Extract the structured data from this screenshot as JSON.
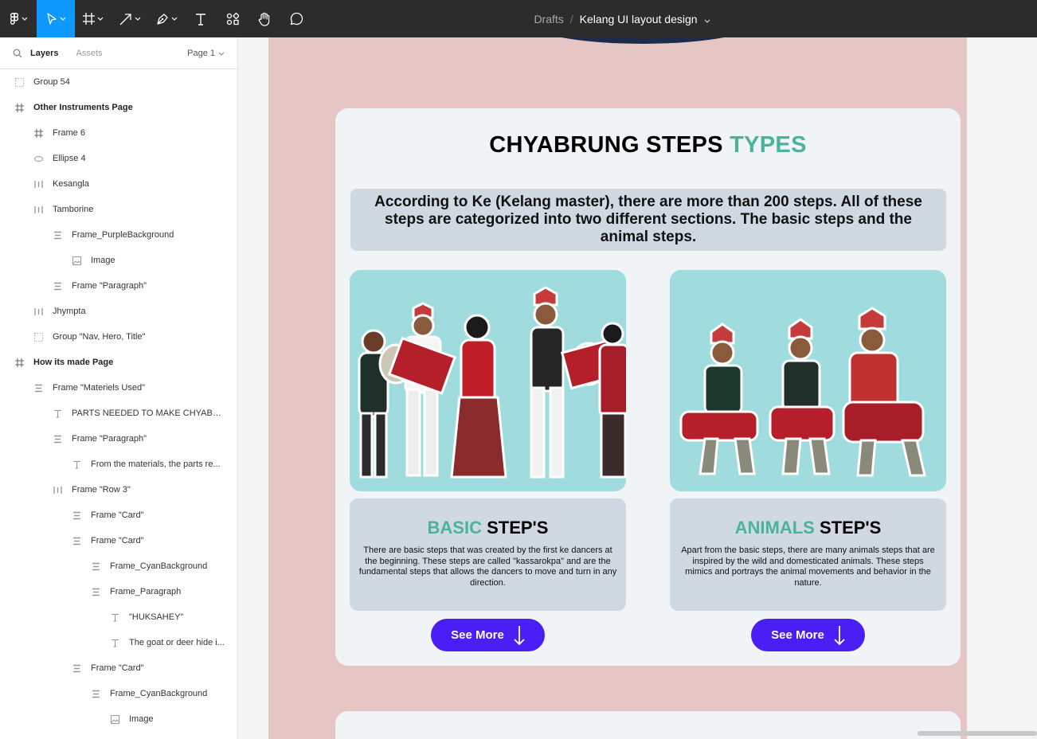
{
  "toolbar": {
    "breadcrumb_root": "Drafts",
    "breadcrumb_sep": "/",
    "file_name": "Kelang UI layout design",
    "accent_color": "#0d99ff"
  },
  "panel": {
    "tab_layers": "Layers",
    "tab_assets": "Assets",
    "page_selector": "Page 1",
    "layers": [
      {
        "label": "Group 54",
        "icon": "group-icon"
      },
      {
        "label": "Other Instruments Page",
        "icon": "frame-icon"
      },
      {
        "label": "Frame 6",
        "icon": "frame-icon"
      },
      {
        "label": "Ellipse 4",
        "icon": "ellipse-icon"
      },
      {
        "label": "Kesangla",
        "icon": "autolayout-horizontal-icon"
      },
      {
        "label": "Tamborine",
        "icon": "autolayout-horizontal-icon"
      },
      {
        "label": "Frame_PurpleBackground",
        "icon": "autolayout-vertical-icon"
      },
      {
        "label": "Image",
        "icon": "image-icon"
      },
      {
        "label": "Frame \"Paragraph\"",
        "icon": "autolayout-vertical-icon"
      },
      {
        "label": "Jhympta",
        "icon": "autolayout-horizontal-icon"
      },
      {
        "label": "Group \"Nav, Hero, Title\"",
        "icon": "group-icon"
      },
      {
        "label": "How its made Page",
        "icon": "frame-icon"
      },
      {
        "label": "Frame \"Materiels Used\"",
        "icon": "autolayout-vertical-icon"
      },
      {
        "label": "PARTS NEEDED TO MAKE CHYABRU...",
        "icon": "text-icon"
      },
      {
        "label": "Frame \"Paragraph\"",
        "icon": "autolayout-vertical-icon"
      },
      {
        "label": "From the materials, the parts re...",
        "icon": "text-icon"
      },
      {
        "label": "Frame \"Row 3\"",
        "icon": "autolayout-horizontal-icon"
      },
      {
        "label": "Frame \"Card\"",
        "icon": "autolayout-vertical-icon"
      },
      {
        "label": "Frame \"Card\"",
        "icon": "autolayout-vertical-icon"
      },
      {
        "label": "Frame_CyanBackground",
        "icon": "autolayout-vertical-icon"
      },
      {
        "label": "Frame_Paragraph",
        "icon": "autolayout-vertical-icon"
      },
      {
        "label": "\"HUKSAHEY\"",
        "icon": "text-icon"
      },
      {
        "label": "The goat or deer hide i...",
        "icon": "text-icon"
      },
      {
        "label": "Frame \"Card\"",
        "icon": "autolayout-vertical-icon"
      },
      {
        "label": "Frame_CyanBackground",
        "icon": "autolayout-vertical-icon"
      },
      {
        "label": "Image",
        "icon": "image-icon"
      }
    ]
  },
  "canvas": {
    "title_main": "CHYABRUNG STEPS ",
    "title_accent": "TYPES",
    "intro": "According to Ke (Kelang master), there are more than 200 steps. All of these steps are categorized into two different sections. The basic steps and the animal steps.",
    "cards": [
      {
        "title_accent": "BASIC",
        "title_rest": " STEP'S",
        "body": "There are basic steps that was created by the first ke dancers at the beginning. These steps are called \"kassarokpa\" and are the fundamental steps that allows the dancers to move and turn in any direction.",
        "button": "See More"
      },
      {
        "title_accent": "ANIMALS",
        "title_rest": " STEP'S",
        "body": "Apart from the basic steps, there are many animals steps that are inspired by the wild and domesticated animals. These steps mimics and portrays the animal movements and behavior in the nature.",
        "button": "See More"
      }
    ],
    "colors": {
      "page_bg": "#e6c5c5",
      "card_bg": "#f1f4f7",
      "teal": "#4cb39b",
      "button": "#4a1ff5",
      "image_bg": "#a0dcde"
    }
  }
}
